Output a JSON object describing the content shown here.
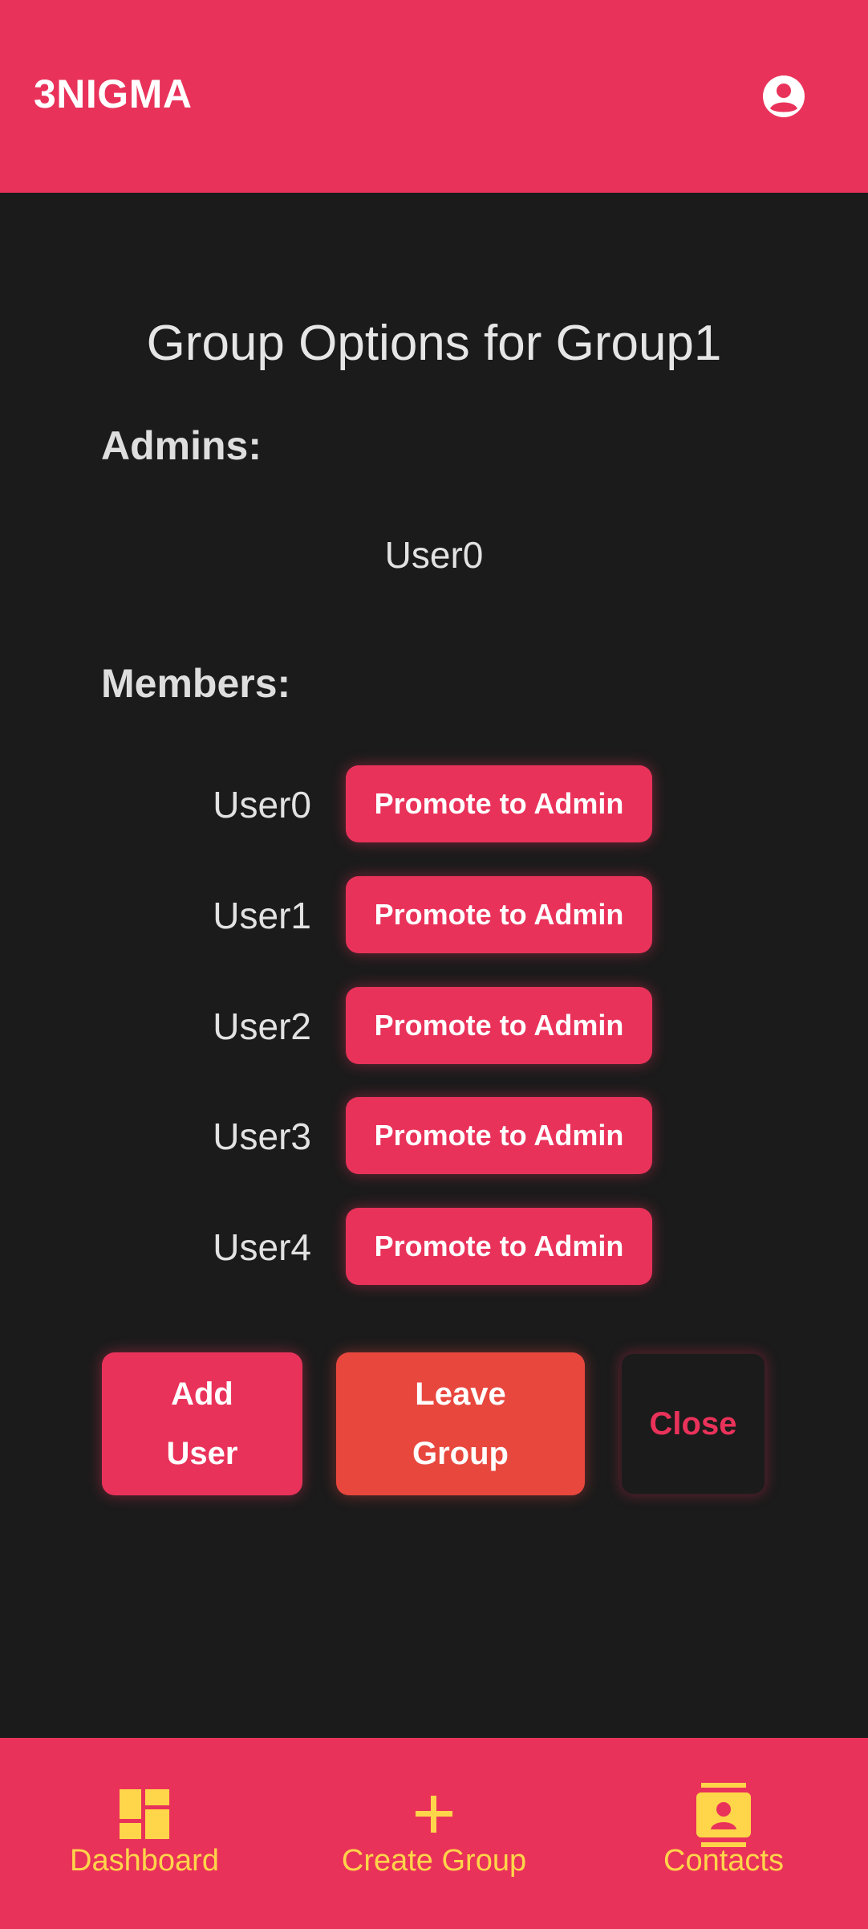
{
  "header": {
    "brand": "3NIGMA",
    "account_icon": "account-circle-icon"
  },
  "page": {
    "title": "Group Options for Group1",
    "admins_label": "Admins:",
    "members_label": "Members:"
  },
  "admins": [
    "User0"
  ],
  "members": [
    {
      "name": "User0",
      "action": "Promote to Admin"
    },
    {
      "name": "User1",
      "action": "Promote to Admin"
    },
    {
      "name": "User2",
      "action": "Promote to Admin"
    },
    {
      "name": "User3",
      "action": "Promote to Admin"
    },
    {
      "name": "User4",
      "action": "Promote to Admin"
    }
  ],
  "actions": {
    "add_user": [
      "Add",
      "User"
    ],
    "leave_group": [
      "Leave",
      "Group"
    ],
    "close": "Close"
  },
  "bottom_nav": [
    {
      "label": "Dashboard",
      "icon": "dashboard-icon"
    },
    {
      "label": "Create Group",
      "icon": "plus-icon"
    },
    {
      "label": "Contacts",
      "icon": "contacts-icon"
    }
  ],
  "colors": {
    "primary": "#e9325a",
    "danger": "#e8473e",
    "accent": "#ffd54a",
    "background": "#1b1b1b"
  }
}
